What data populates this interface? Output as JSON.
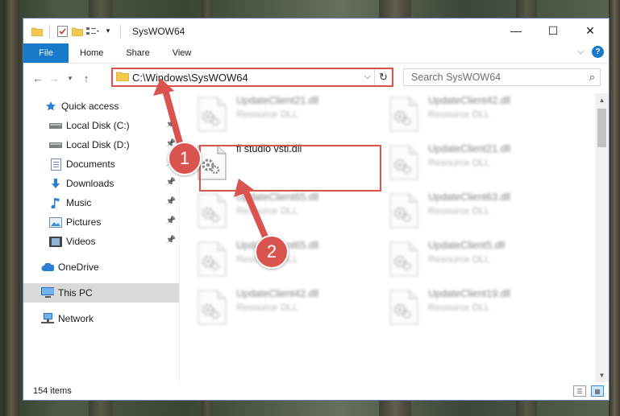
{
  "window": {
    "title": "SysWOW64",
    "controls": {
      "minimize": "—",
      "maximize": "☐",
      "close": "✕"
    }
  },
  "ribbon": {
    "tabs": [
      "File",
      "Home",
      "Share",
      "View"
    ],
    "help": "?"
  },
  "address": {
    "path": "C:\\Windows\\SysWOW64",
    "search_placeholder": "Search SysWOW64"
  },
  "sidebar": {
    "items": [
      {
        "label": "Quick access",
        "icon": "star-icon"
      },
      {
        "label": "Local Disk (C:)",
        "icon": "drive-icon",
        "pinned": true
      },
      {
        "label": "Local Disk (D:)",
        "icon": "drive-icon",
        "pinned": true
      },
      {
        "label": "Documents",
        "icon": "documents-icon",
        "pinned": true
      },
      {
        "label": "Downloads",
        "icon": "downloads-icon",
        "pinned": true
      },
      {
        "label": "Music",
        "icon": "music-icon",
        "pinned": true
      },
      {
        "label": "Pictures",
        "icon": "pictures-icon",
        "pinned": true
      },
      {
        "label": "Videos",
        "icon": "videos-icon",
        "pinned": true
      },
      {
        "label": "OneDrive",
        "icon": "cloud-icon"
      },
      {
        "label": "This PC",
        "icon": "computer-icon",
        "selected": true
      },
      {
        "label": "Network",
        "icon": "network-icon"
      }
    ]
  },
  "files": {
    "left": [
      {
        "name": "UpdateClient21.dll",
        "type": "Resource DLL"
      },
      {
        "name": "fl studio vsti.dll",
        "type": ""
      },
      {
        "name": "UpdateClient65.dll",
        "type": "Resource DLL"
      },
      {
        "name": "UpdateClient65.dll",
        "type": "Resource DLL"
      },
      {
        "name": "UpdateClient42.dll",
        "type": "Resource DLL"
      }
    ],
    "right": [
      {
        "name": "UpdateClient42.dll",
        "type": "Resource DLL"
      },
      {
        "name": "UpdateClient21.dll",
        "type": "Resource DLL"
      },
      {
        "name": "UpdateClient63.dll",
        "type": "Resource DLL"
      },
      {
        "name": "UpdateClient5.dll",
        "type": "Resource DLL"
      },
      {
        "name": "UpdateClient19.dll",
        "type": "Resource DLL"
      }
    ]
  },
  "status": {
    "item_count": "154 items"
  },
  "annotations": {
    "step1": "1",
    "step2": "2",
    "color": "#d9534f"
  },
  "colors": {
    "accent": "#1979ca",
    "highlight": "#d9534f",
    "selected": "#d9d9d9"
  }
}
